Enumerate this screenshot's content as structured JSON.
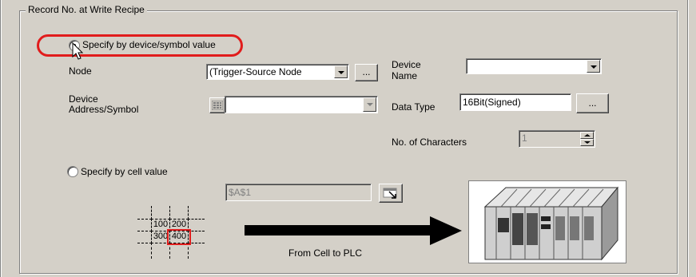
{
  "group_title": "Record No. at Write Recipe",
  "radio_device": {
    "label": "Specify by device/symbol value",
    "checked": true
  },
  "node": {
    "label": "Node",
    "value": "(Trigger-Source Node",
    "button": "..."
  },
  "device_name": {
    "label_line1": "Device",
    "label_line2": "Name",
    "value": ""
  },
  "device_address": {
    "label_line1": "Device",
    "label_line2": "Address/Symbol",
    "value": ""
  },
  "data_type": {
    "label": "Data Type",
    "value": "16Bit(Signed)",
    "button": "..."
  },
  "num_chars": {
    "label": "No. of Characters",
    "value": "1"
  },
  "radio_cell": {
    "label": "Specify by cell value",
    "checked": false
  },
  "cell_field": {
    "value": "$A$1"
  },
  "illustration": {
    "cells": [
      "100",
      "200",
      "300",
      "400"
    ],
    "caption": "From Cell to PLC"
  },
  "colors": {
    "highlight": "#e11c1c",
    "face": "#d4d0c8"
  }
}
